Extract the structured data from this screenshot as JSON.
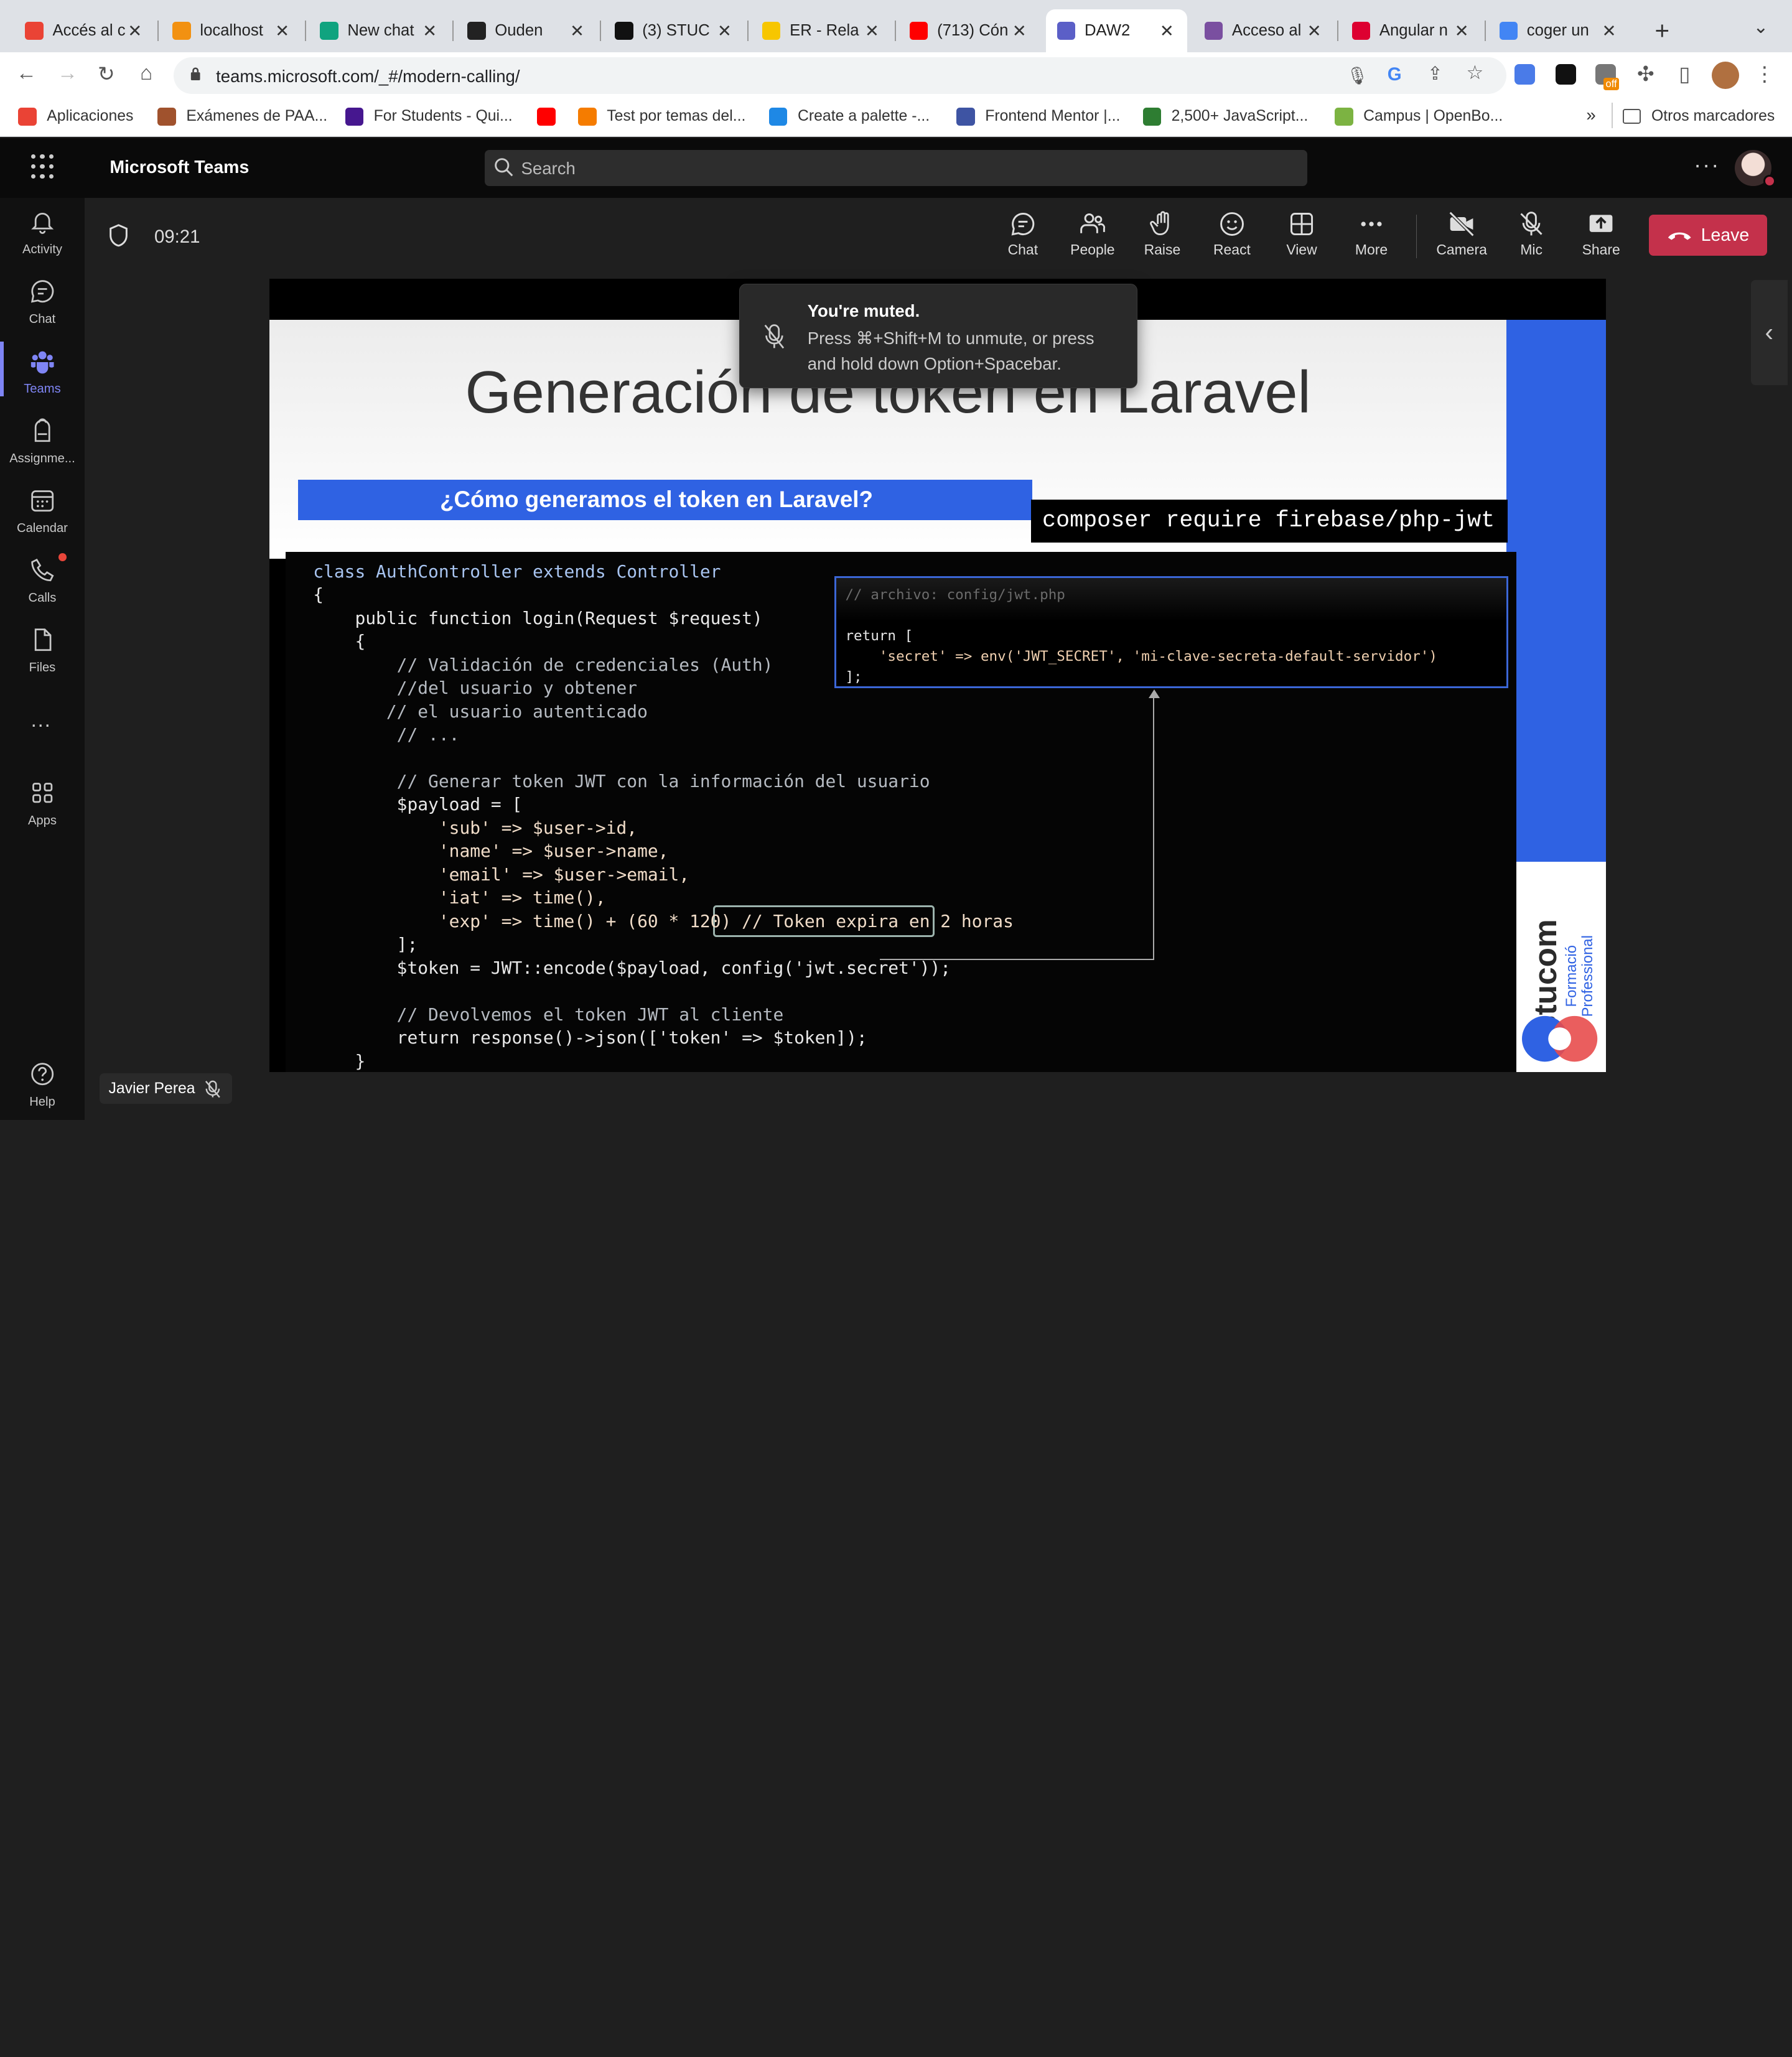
{
  "browser": {
    "tabs": [
      {
        "title": "Accés al c",
        "color": "#ea4335"
      },
      {
        "title": "localhost",
        "color": "#f29111"
      },
      {
        "title": "New chat",
        "color": "#10a37f"
      },
      {
        "title": "Ouden",
        "color": "#222222"
      },
      {
        "title": "(3) STUC",
        "color": "#111111"
      },
      {
        "title": "ER - Rela",
        "color": "#f7c600"
      },
      {
        "title": "(713) Cón",
        "color": "#ff0000"
      },
      {
        "title": "DAW2",
        "color": "#5b5fc7"
      },
      {
        "title": "Acceso al",
        "color": "#7a4fa0"
      },
      {
        "title": "Angular n",
        "color": "#dd0031"
      },
      {
        "title": "coger un",
        "color": "#4285f4"
      }
    ],
    "active_tab": 7,
    "url": "teams.microsoft.com/_#/modern-calling/",
    "bookmarks": [
      {
        "label": "Aplicaciones",
        "color": "#ea4335"
      },
      {
        "label": "Exámenes de PAA...",
        "color": "#a0522d"
      },
      {
        "label": "For Students - Qui...",
        "color": "#46178f"
      },
      {
        "label": "",
        "color": "#ff0000"
      },
      {
        "label": "Test por temas del...",
        "color": "#f57c00"
      },
      {
        "label": "Create a palette -...",
        "color": "#1e88e5"
      },
      {
        "label": "Frontend Mentor |...",
        "color": "#3e54a3"
      },
      {
        "label": "2,500+ JavaScript...",
        "color": "#2e7d32"
      },
      {
        "label": "Campus | OpenBo...",
        "color": "#7cb342"
      }
    ],
    "bookmarks_more": "»",
    "other_bookmarks": "Otros marcadores",
    "ext_badge": "off"
  },
  "teams": {
    "app_title": "Microsoft Teams",
    "search_placeholder": "Search",
    "rail": [
      {
        "label": "Activity",
        "icon": "bell-icon"
      },
      {
        "label": "Chat",
        "icon": "chat-icon"
      },
      {
        "label": "Teams",
        "icon": "teams-icon"
      },
      {
        "label": "Assignme...",
        "icon": "backpack-icon"
      },
      {
        "label": "Calendar",
        "icon": "calendar-icon"
      },
      {
        "label": "Calls",
        "icon": "phone-icon"
      },
      {
        "label": "Files",
        "icon": "file-icon"
      },
      {
        "label": "Apps",
        "icon": "apps-icon"
      },
      {
        "label": "Help",
        "icon": "help-icon"
      }
    ],
    "rail_more": "...",
    "meeting": {
      "time": "09:21",
      "controls": [
        "Chat",
        "People",
        "Raise",
        "React",
        "View",
        "More",
        "Camera",
        "Mic",
        "Share"
      ],
      "leave": "Leave"
    },
    "toast": {
      "title": "You're muted.",
      "body": "Press ⌘+Shift+M to unmute, or press and hold down Option+Spacebar."
    },
    "participant": "Javier Perea"
  },
  "slide": {
    "title": "Generación de token en Laravel",
    "subtitle": "¿Cómo generamos el token en Laravel?",
    "composer": "composer require firebase/php-jwt",
    "config_box": [
      "// archivo: config/jwt.php",
      "",
      "return [",
      "    'secret' => env('JWT_SECRET', 'mi-clave-secreta-default-servidor')",
      "];"
    ],
    "code": [
      "class AuthController extends Controller",
      "{",
      "    public function login(Request $request)",
      "    {",
      "        // Validación de credenciales (Auth)",
      "        //del usuario y obtener",
      "       // el usuario autenticado",
      "        // ...",
      "",
      "        // Generar token JWT con la información del usuario",
      "        $payload = [",
      "            'sub' => $user->id,",
      "            'name' => $user->name,",
      "            'email' => $user->email,",
      "            'iat' => time(),",
      "            'exp' => time() + (60 * 120) // Token expira en 2 horas",
      "        ];",
      "        $token = JWT::encode($payload, config('jwt.secret'));",
      "",
      "        // Devolvemos el token JWT al cliente",
      "        return response()->json(['token' => $token]);",
      "    }"
    ],
    "logo_name": "stucom",
    "logo_sub": [
      "Formació",
      "Professional"
    ]
  }
}
